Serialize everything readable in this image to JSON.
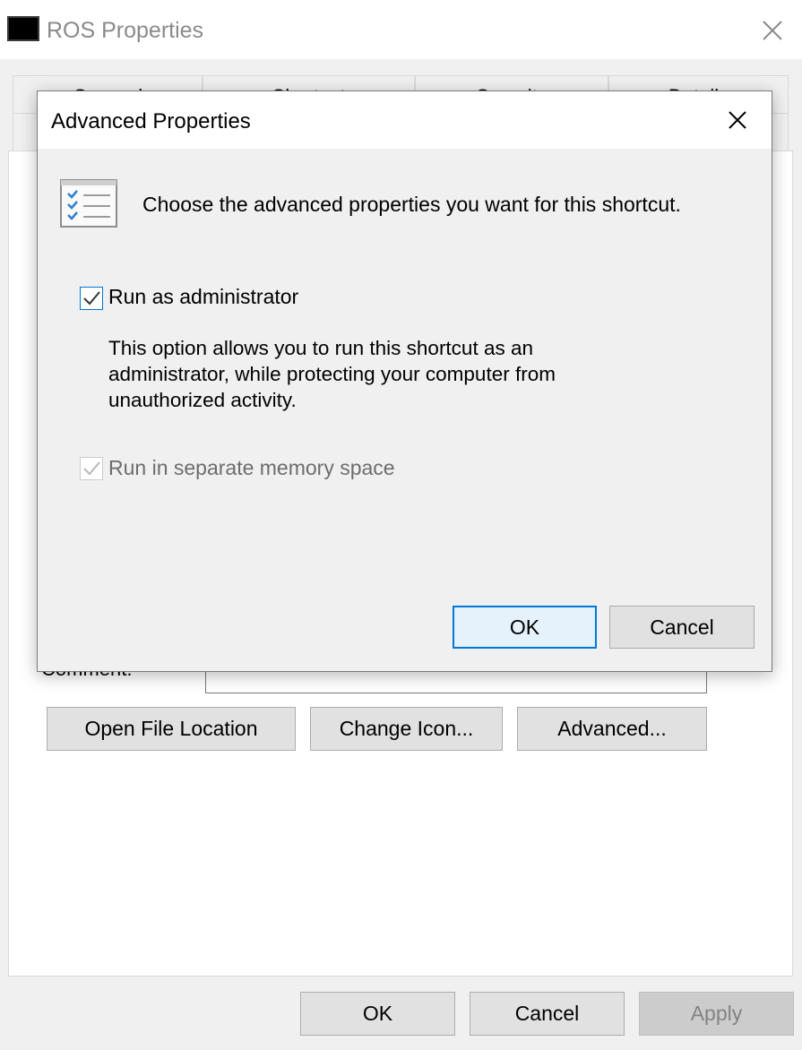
{
  "window": {
    "title": "ROS Properties",
    "tabs": [
      "General",
      "Shortcut",
      "Security",
      "Details"
    ]
  },
  "shortcut_tab": {
    "comment_label": "Comment:",
    "comment_value": "",
    "open_file_location": "Open File Location",
    "change_icon": "Change Icon...",
    "advanced": "Advanced..."
  },
  "footer": {
    "ok": "OK",
    "cancel": "Cancel",
    "apply": "Apply"
  },
  "dialog": {
    "title": "Advanced Properties",
    "heading": "Choose the advanced properties you want for this shortcut.",
    "run_as_admin": {
      "label": "Run as administrator",
      "checked": true,
      "description": "This option allows you to run this shortcut as an administrator, while protecting your computer from unauthorized activity."
    },
    "separate_memory": {
      "label": "Run in separate memory space",
      "checked": true,
      "enabled": false
    },
    "ok": "OK",
    "cancel": "Cancel"
  },
  "colors": {
    "accent": "#0078d7",
    "disabled_text": "#6d6d6d",
    "button_face": "#e1e1e1"
  }
}
